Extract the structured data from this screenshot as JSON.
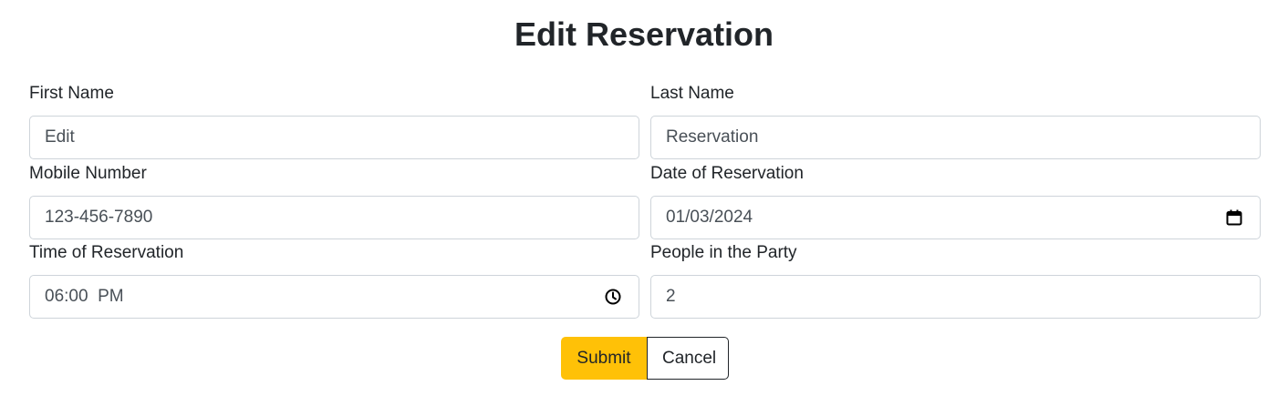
{
  "page": {
    "title": "Edit Reservation"
  },
  "form": {
    "first_name": {
      "label": "First Name",
      "value": "Edit"
    },
    "last_name": {
      "label": "Last Name",
      "value": "Reservation"
    },
    "mobile_number": {
      "label": "Mobile Number",
      "value": "123-456-7890"
    },
    "date": {
      "label": "Date of Reservation",
      "value": "01/03/2024",
      "icon": "calendar-icon"
    },
    "time": {
      "label": "Time of Reservation",
      "value": "06:00  PM",
      "icon": "clock-icon"
    },
    "people": {
      "label": "People in the Party",
      "value": "2"
    }
  },
  "buttons": {
    "submit_label": "Submit",
    "cancel_label": "Cancel"
  },
  "colors": {
    "submit_bg": "#ffc107",
    "border": "#ced4da",
    "text": "#212529"
  }
}
